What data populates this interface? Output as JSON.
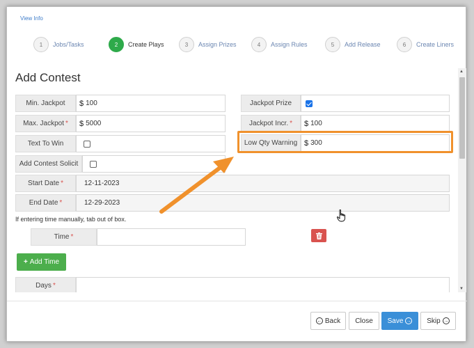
{
  "header": {
    "view_info": "View Info"
  },
  "steps": [
    {
      "num": "1",
      "label": "Jobs/Tasks"
    },
    {
      "num": "2",
      "label": "Create Plays"
    },
    {
      "num": "3",
      "label": "Assign Prizes"
    },
    {
      "num": "4",
      "label": "Assign Rules"
    },
    {
      "num": "5",
      "label": "Add Release"
    },
    {
      "num": "6",
      "label": "Create Liners"
    }
  ],
  "form": {
    "title": "Add Contest",
    "currency": "$",
    "required_marker": "*",
    "min_jackpot": {
      "label": "Min. Jackpot",
      "value": "100"
    },
    "max_jackpot": {
      "label": "Max. Jackpot",
      "value": "5000"
    },
    "text_to_win": {
      "label": "Text To Win"
    },
    "add_contest_solicit": {
      "label": "Add Contest Solicit"
    },
    "jackpot_prize": {
      "label": "Jackpot Prize"
    },
    "jackpot_incr": {
      "label": "Jackpot Incr.",
      "value": "100"
    },
    "low_qty_warning": {
      "label": "Low Qty Warning",
      "value": "300"
    },
    "start_date": {
      "label": "Start Date",
      "value": "12-11-2023"
    },
    "end_date": {
      "label": "End Date",
      "value": "12-29-2023"
    },
    "hint": "If entering time manually, tab out of box.",
    "time": {
      "label": "Time"
    },
    "add_time_label": "Add Time",
    "days": {
      "label": "Days"
    }
  },
  "footer": {
    "back": "Back",
    "close": "Close",
    "save": "Save",
    "skip": "Skip"
  },
  "icons": [
    "trash-icon",
    "plus-icon",
    "back-arrow-icon",
    "forward-arrow-icon",
    "hand-cursor-icon"
  ],
  "colors": {
    "accent": "#f0912c",
    "success": "#4cae4c",
    "primary": "#3a8fd8",
    "danger": "#d9534f",
    "active_step": "#2eaa4a"
  }
}
